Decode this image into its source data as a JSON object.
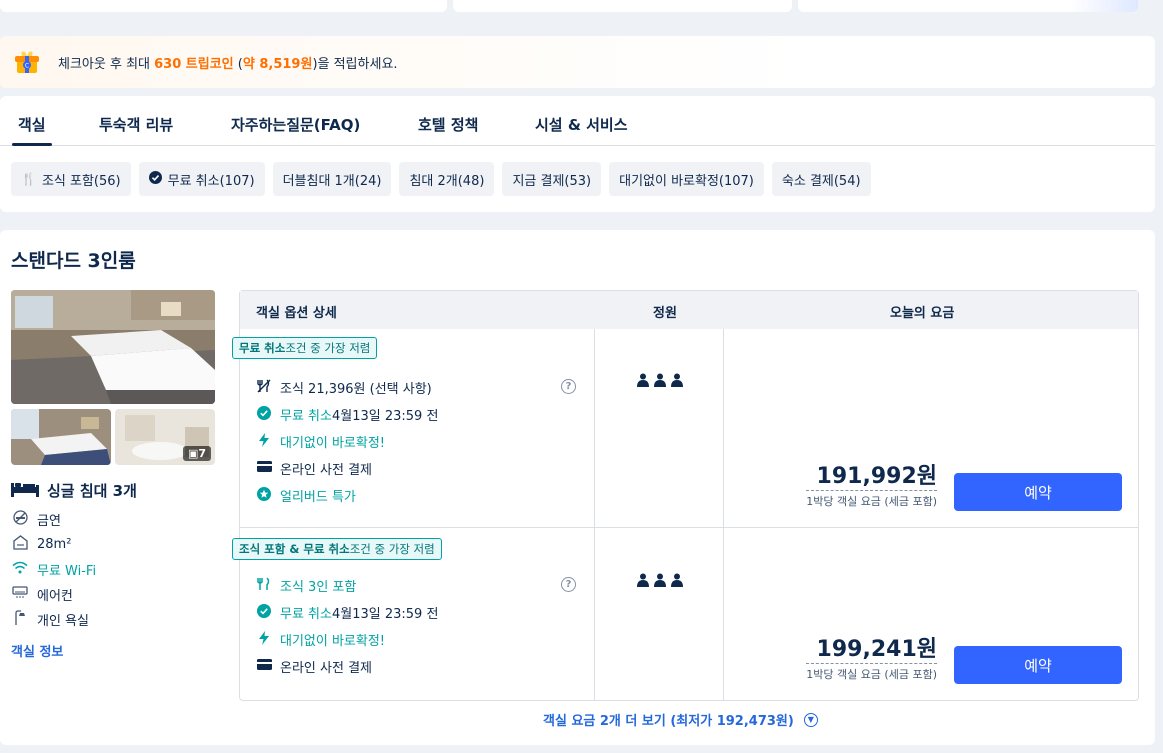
{
  "promo": {
    "prefix": "체크아웃 후 최대 ",
    "coins": "630 트립코인",
    "mid": " (",
    "approx": "약 8,519원",
    "suffix": ")을 적립하세요."
  },
  "tabs": [
    {
      "label": "객실",
      "active": true
    },
    {
      "label": "투숙객 리뷰"
    },
    {
      "label": "자주하는질문(FAQ)"
    },
    {
      "label": "호텔 정책"
    },
    {
      "label": "시설 & 서비스"
    }
  ],
  "chips": [
    {
      "label": "조식 포함(56)",
      "icon": "utensils-icon"
    },
    {
      "label": "무료 취소(107)",
      "icon": "check-circle-icon"
    },
    {
      "label": "더블침대 1개(24)"
    },
    {
      "label": "침대 2개(48)"
    },
    {
      "label": "지금 결제(53)"
    },
    {
      "label": "대기없이 바로확정(107)"
    },
    {
      "label": "숙소 결제(54)"
    }
  ],
  "room": {
    "title": "스탠다드 3인룸",
    "photo_count": "7",
    "bed": "싱글 침대 3개",
    "amenities": [
      "금연",
      "28m²",
      "무료 Wi-Fi",
      "에어컨",
      "개인 욕실"
    ],
    "info_link": "객실 정보"
  },
  "table": {
    "headers": [
      "객실 옵션 상세",
      "정원",
      "오늘의 요금"
    ],
    "rows": [
      {
        "badge_bold": "무료 취소",
        "badge_rest": " 조건 중 가장 저렴",
        "opts": [
          {
            "text": "조식 21,396원 (선택 사항)"
          },
          {
            "text": "무료 취소",
            "extra": " 4월13일 23:59 전"
          },
          {
            "text": "대기없이 바로확정!"
          },
          {
            "text": "온라인 사전 결제"
          },
          {
            "text": "얼리버드 특가"
          }
        ],
        "price": "191,992원",
        "note": "1박당 객실 요금 (세금 포함)",
        "book": "예약"
      },
      {
        "badge_bold": "조식 포함 & 무료 취소",
        "badge_rest": " 조건 중 가장 저렴",
        "opts": [
          {
            "text": "조식 3인 포함"
          },
          {
            "text": "무료 취소",
            "extra": " 4월13일 23:59 전"
          },
          {
            "text": "대기없이 바로확정!"
          },
          {
            "text": "온라인 사전 결제"
          }
        ],
        "price": "199,241원",
        "note": "1박당 객실 요금 (세금 포함)",
        "book": "예약"
      }
    ]
  },
  "more": "객실 요금 2개 더 보기 (최저가 192,473원)",
  "colors": {
    "accent": "#3264ff",
    "teal": "#00a3a3",
    "coin": "#ff6f00",
    "link": "#2469db"
  }
}
